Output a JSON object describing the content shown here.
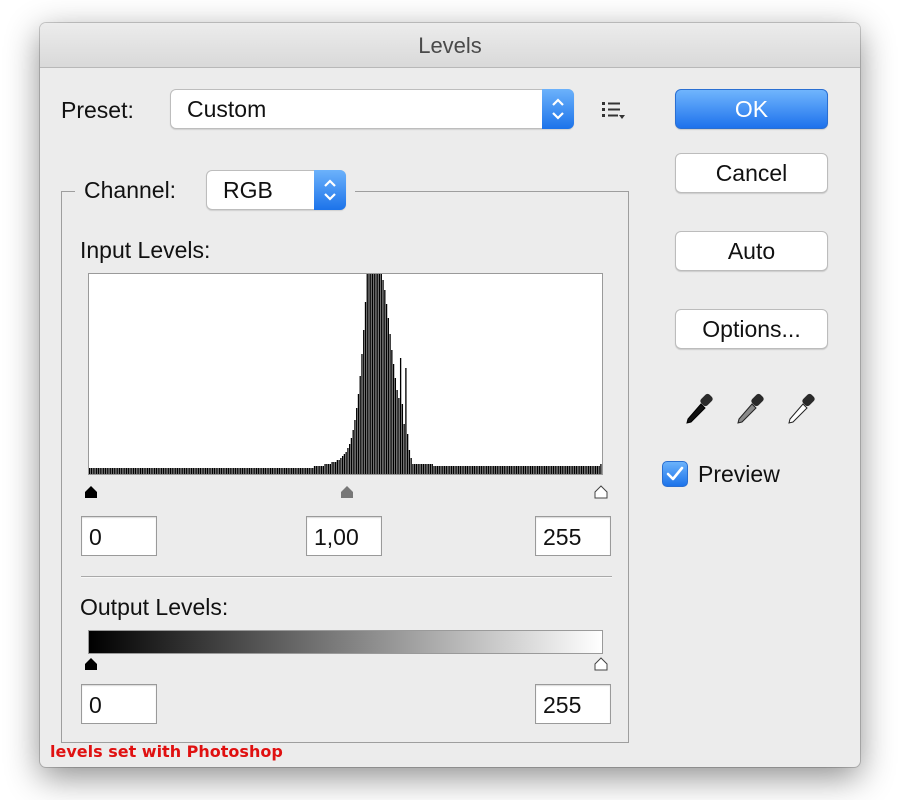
{
  "window": {
    "title": "Levels"
  },
  "preset": {
    "label": "Preset:",
    "value": "Custom"
  },
  "channel": {
    "label": "Channel:",
    "value": "RGB"
  },
  "input_levels": {
    "label": "Input Levels:",
    "black": "0",
    "gamma": "1,00",
    "white": "255",
    "histogram": [
      3,
      3,
      3,
      3,
      3,
      3,
      3,
      3,
      3,
      3,
      3,
      3,
      3,
      3,
      3,
      3,
      3,
      3,
      3,
      3,
      3,
      3,
      3,
      3,
      3,
      3,
      3,
      3,
      3,
      3,
      3,
      3,
      3,
      3,
      3,
      3,
      3,
      3,
      3,
      3,
      3,
      3,
      3,
      3,
      3,
      3,
      3,
      3,
      3,
      3,
      3,
      3,
      3,
      3,
      3,
      3,
      3,
      3,
      3,
      3,
      3,
      3,
      3,
      3,
      3,
      3,
      3,
      3,
      3,
      3,
      3,
      3,
      3,
      3,
      3,
      3,
      3,
      3,
      3,
      3,
      3,
      3,
      3,
      3,
      3,
      3,
      3,
      3,
      3,
      3,
      3,
      3,
      3,
      3,
      3,
      3,
      3,
      3,
      3,
      3,
      3,
      3,
      3,
      3,
      3,
      3,
      3,
      3,
      3,
      3,
      3,
      3,
      3,
      3,
      3,
      3,
      3,
      3,
      3,
      3,
      3,
      3,
      3,
      3,
      3,
      3,
      3,
      3,
      4,
      4,
      4,
      4,
      4,
      4,
      5,
      5,
      5,
      5,
      6,
      6,
      6,
      7,
      7,
      8,
      9,
      10,
      11,
      13,
      15,
      18,
      22,
      27,
      33,
      40,
      49,
      60,
      72,
      86,
      100,
      100,
      100,
      100,
      100,
      100,
      100,
      100,
      100,
      97,
      92,
      85,
      78,
      70,
      62,
      55,
      48,
      42,
      38,
      58,
      35,
      25,
      53,
      20,
      12,
      8,
      5,
      5,
      5,
      5,
      5,
      5,
      5,
      5,
      5,
      5,
      5,
      5,
      4,
      4,
      4,
      4,
      4,
      4,
      4,
      4,
      4,
      4,
      4,
      4,
      4,
      4,
      4,
      4,
      4,
      4,
      4,
      4,
      4,
      4,
      4,
      4,
      4,
      4,
      4,
      4,
      4,
      4,
      4,
      4,
      4,
      4,
      4,
      4,
      4,
      4,
      4,
      4,
      4,
      4,
      4,
      4,
      4,
      4,
      4,
      4,
      4,
      4,
      4,
      4,
      4,
      4,
      4,
      4,
      4,
      4,
      4,
      4,
      4,
      4,
      4,
      4,
      4,
      4,
      4,
      4,
      4,
      4,
      4,
      4,
      4,
      4,
      4,
      4,
      4,
      4,
      4,
      4,
      4,
      4,
      4,
      4,
      4,
      4,
      4,
      4,
      4,
      4,
      4,
      4,
      4,
      4,
      4,
      5
    ]
  },
  "output_levels": {
    "label": "Output Levels:",
    "black": "0",
    "white": "255"
  },
  "buttons": {
    "ok": "OK",
    "cancel": "Cancel",
    "auto": "Auto",
    "options": "Options..."
  },
  "eyedroppers": [
    "black-point-eyedropper",
    "gray-point-eyedropper",
    "white-point-eyedropper"
  ],
  "preview": {
    "label": "Preview",
    "checked": true
  },
  "caption": "levels set with Photoshop",
  "colors": {
    "accent": "#1c73ea",
    "caption": "#e01010"
  }
}
